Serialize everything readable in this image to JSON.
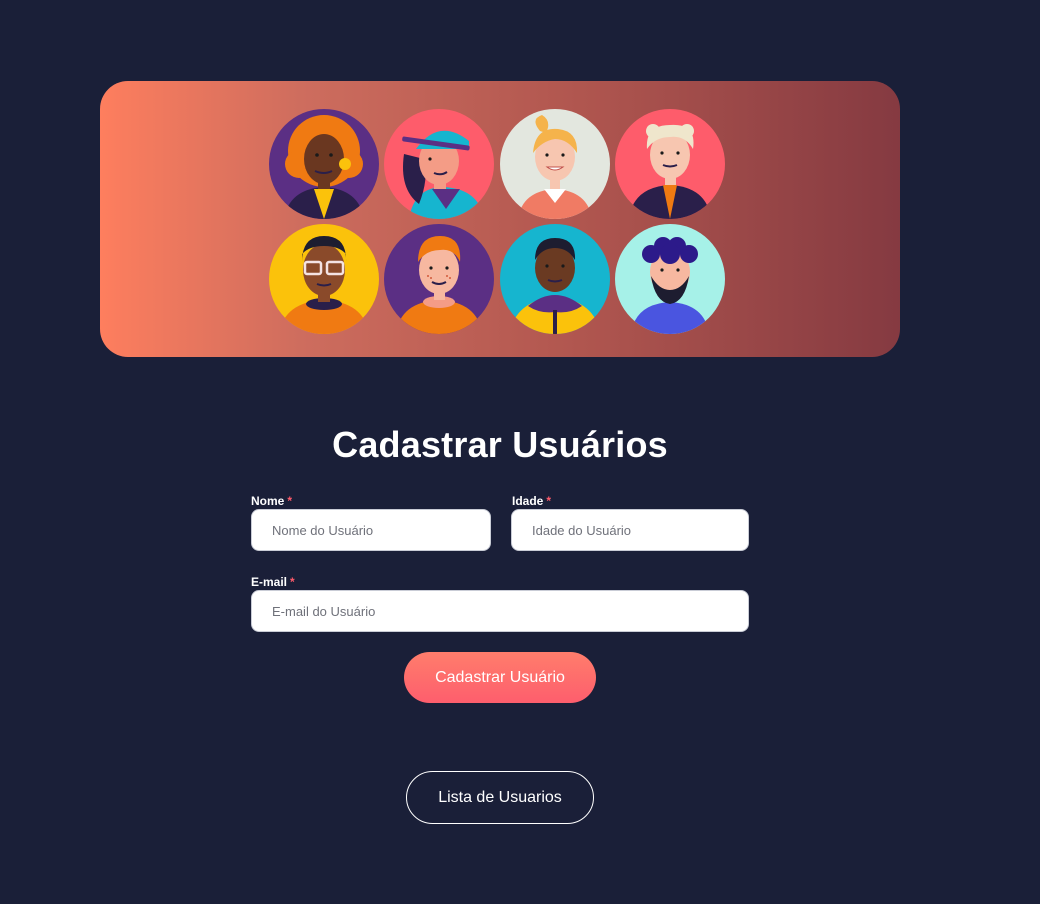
{
  "banner": {
    "avatars": [
      {
        "name": "avatar-curly-orange-hair",
        "bg": "#5b2f84"
      },
      {
        "name": "avatar-teal-cap",
        "bg": "#fe5c6b"
      },
      {
        "name": "avatar-blonde-ponytail",
        "bg": "#e3e7df"
      },
      {
        "name": "avatar-platinum-hair",
        "bg": "#fe5c6b"
      },
      {
        "name": "avatar-glasses",
        "bg": "#fbc20b"
      },
      {
        "name": "avatar-ginger-freckles",
        "bg": "#5b2f84"
      },
      {
        "name": "avatar-hoodie",
        "bg": "#16b5cf"
      },
      {
        "name": "avatar-curly-beard",
        "bg": "#a6f1e8"
      }
    ]
  },
  "form": {
    "title": "Cadastrar Usuários",
    "required_mark": "*",
    "nome": {
      "label": "Nome",
      "placeholder": "Nome do Usuário",
      "value": ""
    },
    "idade": {
      "label": "Idade",
      "placeholder": "Idade do Usuário",
      "value": ""
    },
    "email": {
      "label": "E-mail",
      "placeholder": "E-mail do Usuário",
      "value": ""
    },
    "submit_label": "Cadastrar Usuário"
  },
  "nav": {
    "list_label": "Lista de Usuarios"
  },
  "colors": {
    "background": "#1a1f38",
    "accent": "#fe5e6d",
    "required": "#ff5b6b"
  }
}
